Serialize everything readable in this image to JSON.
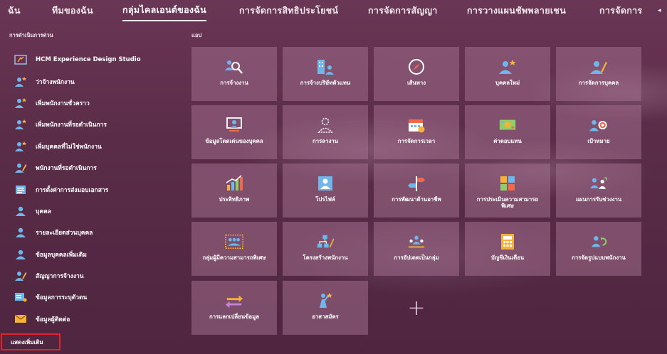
{
  "tabs": [
    {
      "label": "ฉัน",
      "active": false
    },
    {
      "label": "ทีมของฉัน",
      "active": false
    },
    {
      "label": "กลุ่มไคลเอนต์ของฉัน",
      "active": true
    },
    {
      "label": "การจัดการสิทธิประโยชน์",
      "active": false
    },
    {
      "label": "การจัดการสัญญา",
      "active": false
    },
    {
      "label": "การวางแผนชัพพลายเชน",
      "active": false
    },
    {
      "label": "การจัดการ",
      "active": false
    }
  ],
  "quick_actions": {
    "title": "การดำเนินการด่วน",
    "items": [
      {
        "label": "HCM Experience Design Studio",
        "icon": "design-studio-icon"
      },
      {
        "label": "ว่าจ้างพนักงาน",
        "icon": "hire-employee-icon"
      },
      {
        "label": "เพิ่มพนักงานชั่วคราว",
        "icon": "add-contingent-icon"
      },
      {
        "label": "เพิ่มพนักงานที่รอดำเนินการ",
        "icon": "add-pending-worker-icon"
      },
      {
        "label": "เพิ่มบุคคลที่ไม่ใช่พนักงาน",
        "icon": "add-nonworker-icon"
      },
      {
        "label": "พนักงานที่รอดำเนินการ",
        "icon": "pending-workers-icon"
      },
      {
        "label": "การตั้งค่าการส่งมอบเอกสาร",
        "icon": "document-delivery-icon"
      },
      {
        "label": "บุคคล",
        "icon": "person-icon"
      },
      {
        "label": "รายละเอียดส่วนบุคคล",
        "icon": "personal-details-icon"
      },
      {
        "label": "ข้อมูลบุคคลเพิ่มเติม",
        "icon": "additional-info-icon"
      },
      {
        "label": "สัญญาการจ้างงาน",
        "icon": "employment-contract-icon"
      },
      {
        "label": "ข้อมูลการระบุตัวตน",
        "icon": "identification-icon"
      },
      {
        "label": "ข้อมูลผู้ติดต่อ",
        "icon": "contact-info-icon"
      }
    ],
    "show_more": "แสดงเพิ่มเติม"
  },
  "apps": {
    "title": "แอป",
    "tiles": [
      {
        "label": "การจ้างงาน",
        "icon": "hiring-icon"
      },
      {
        "label": "การจ้างบริษัทตัวแทน",
        "icon": "agency-hiring-icon"
      },
      {
        "label": "เส้นทาง",
        "icon": "compass-icon"
      },
      {
        "label": "บุคคลใหม่",
        "icon": "new-person-icon"
      },
      {
        "label": "การจัดการบุคคล",
        "icon": "person-management-icon"
      },
      {
        "label": "ข้อมูลโดดเด่นของบุคคล",
        "icon": "person-spotlight-icon"
      },
      {
        "label": "การลางาน",
        "icon": "absence-icon"
      },
      {
        "label": "การจัดการเวลา",
        "icon": "calendar-icon"
      },
      {
        "label": "ค่าตอบแทน",
        "icon": "compensation-icon"
      },
      {
        "label": "เป้าหมาย",
        "icon": "goals-icon"
      },
      {
        "label": "ประสิทธิภาพ",
        "icon": "performance-icon"
      },
      {
        "label": "โปรไฟล์",
        "icon": "profile-icon"
      },
      {
        "label": "การพัฒนาด้านอาชีพ",
        "icon": "career-development-icon"
      },
      {
        "label": "การประเมินความสามารถพิเศษ",
        "icon": "talent-review-icon"
      },
      {
        "label": "แผนการรับช่วงงาน",
        "icon": "succession-icon"
      },
      {
        "label": "กลุ่มผู้มีความสามารถพิเศษ",
        "icon": "talent-pool-icon"
      },
      {
        "label": "โครงสร้างพนักงาน",
        "icon": "workforce-structure-icon"
      },
      {
        "label": "การอัปเดตเป็นกลุ่ม",
        "icon": "mass-update-icon"
      },
      {
        "label": "บัญชีเงินเดือน",
        "icon": "payroll-icon"
      },
      {
        "label": "การจัดรูปแบบพนักงาน",
        "icon": "workforce-modeling-icon"
      },
      {
        "label": "การแลกเปลี่ยนข้อมูล",
        "icon": "data-exchange-icon"
      },
      {
        "label": "อาสาสมัคร",
        "icon": "volunteer-icon"
      }
    ]
  }
}
